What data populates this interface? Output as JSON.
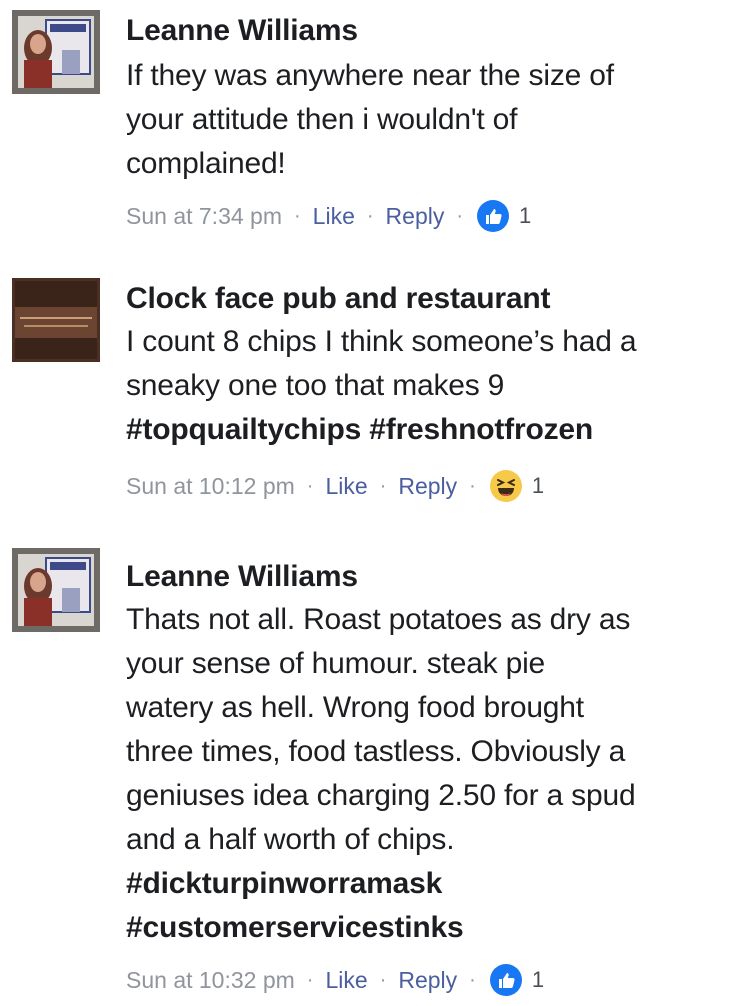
{
  "comments": [
    {
      "author": "Leanne Williams",
      "lines": [
        "If they was anywhere near the size of",
        "your attitude then i wouldn't of",
        "complained!"
      ],
      "tags": [],
      "time": "Sun at 7:34 pm",
      "like_label": "Like",
      "reply_label": "Reply",
      "reaction": "like-icon",
      "reaction_count": "1"
    },
    {
      "author": "Clock face pub and restaurant",
      "lines": [
        "I count 8 chips I think someone’s had a",
        "sneaky one too that makes 9"
      ],
      "tags": [
        "#topquailtychips #freshnotfrozen"
      ],
      "time": "Sun at 10:12 pm",
      "like_label": "Like",
      "reply_label": "Reply",
      "reaction": "haha-icon",
      "reaction_count": "1"
    },
    {
      "author": "Leanne Williams",
      "lines": [
        "Thats not all. Roast potatoes as dry as",
        "your sense of humour. steak pie",
        "watery as hell. Wrong food brought",
        "three times, food tastless. Obviously a",
        "geniuses idea charging 2.50 for a spud",
        "and a half worth of chips."
      ],
      "tags": [
        "#dickturpinworramask",
        "#customerservicestinks"
      ],
      "time": "Sun at 10:32 pm",
      "like_label": "Like",
      "reply_label": "Reply",
      "reaction": "like-icon",
      "reaction_count": "1"
    }
  ],
  "colors": {
    "text": "#1c1e21",
    "meta": "#90949c",
    "link": "#4b5fa0",
    "like_blue": "#1877f2",
    "haha_yellow": "#f7c948"
  }
}
